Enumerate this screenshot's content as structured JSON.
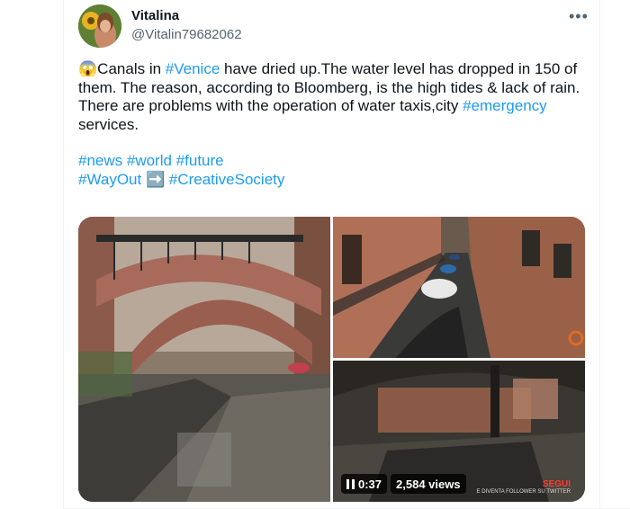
{
  "author": {
    "display_name": "Vitalina",
    "handle": "@Vitalin79682062"
  },
  "more_icon": "more-options-icon",
  "tweet": {
    "line1_emoji": "😱",
    "line1_a": "Canals in ",
    "line1_tag": "#Venice",
    "line1_b": " have dried up.The water level has dropped in 150 of them. The reason, according to Bloomberg, is the high tides & lack of rain.",
    "line2_a": "There are problems with the operation of water taxis,city ",
    "line2_tag": "#emergency",
    "line2_b": " services.",
    "tags_row1": [
      "#news",
      "#world",
      "#future"
    ],
    "tag_wayout": "#WayOut",
    "arrow_emoji": "➡️",
    "tag_creative": "#CreativeSociety"
  },
  "video": {
    "time": "0:37",
    "views": "2,584 views",
    "caption_overlay": "SEGUI",
    "caption_sub": "E DIVENTA FOLLOWER SU TWITTER"
  },
  "colors": {
    "link": "#1d9bf0",
    "text": "#0f1419",
    "secondary": "#536471"
  }
}
